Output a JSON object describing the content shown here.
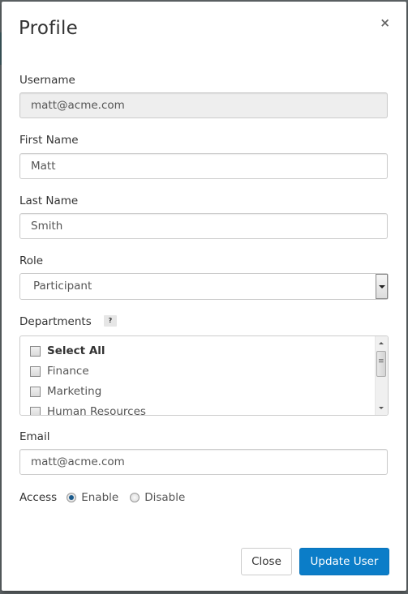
{
  "modal": {
    "title": "Profile",
    "close_icon": "×"
  },
  "form": {
    "username": {
      "label": "Username",
      "value": "matt@acme.com"
    },
    "first_name": {
      "label": "First Name",
      "value": "Matt"
    },
    "last_name": {
      "label": "Last Name",
      "value": "Smith"
    },
    "role": {
      "label": "Role",
      "selected": "Participant"
    },
    "departments": {
      "label": "Departments",
      "help": "?",
      "items": [
        {
          "label": "Select All",
          "checked": false
        },
        {
          "label": "Finance",
          "checked": false
        },
        {
          "label": "Marketing",
          "checked": false
        },
        {
          "label": "Human Resources",
          "checked": false
        }
      ]
    },
    "email": {
      "label": "Email",
      "value": "matt@acme.com"
    },
    "access": {
      "label": "Access",
      "options": [
        {
          "label": "Enable",
          "checked": true
        },
        {
          "label": "Disable",
          "checked": false
        }
      ]
    }
  },
  "footer": {
    "close_label": "Close",
    "update_label": "Update User"
  },
  "colors": {
    "primary": "#0b7dc8",
    "readonly_bg": "#eeeeee"
  }
}
